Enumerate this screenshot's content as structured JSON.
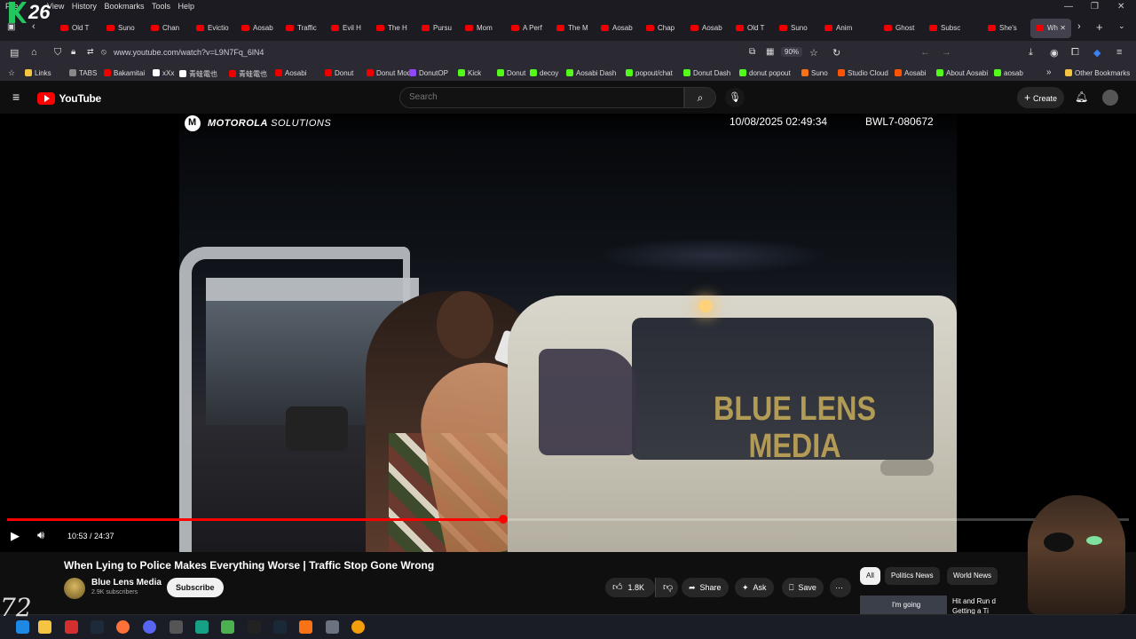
{
  "browser": {
    "menu": [
      "File",
      "View",
      "History",
      "Bookmarks",
      "Tools",
      "Help"
    ],
    "tabs": [
      "Old T",
      "Suno",
      "Chan",
      "Evictio",
      "Aosab",
      "Traffic",
      "Evil H",
      "The H",
      "Pursu",
      "Mom",
      "A Perf",
      "The M",
      "Aosab",
      "Chap",
      "Aosab",
      "Old T",
      "Suno",
      "Anim",
      "Ghost",
      "Subsc",
      "She's",
      "Wh"
    ],
    "url": "www.youtube.com/watch?v=L9N7Fq_6lN4",
    "zoom": "90%",
    "bookmarks": [
      "Links",
      "TABS",
      "Bakamitai",
      "xXx",
      "青蛙電也",
      "青蛙電也",
      "Aosabi",
      "Donut",
      "Donut Mod",
      "DonutOP",
      "Kick",
      "Donut",
      "decoy",
      "Aosabi Dash",
      "popout/chat",
      "Donut Dash",
      "donut popout",
      "Suno",
      "Studio Cloud",
      "Aosabi",
      "About Aosabi",
      "aosab",
      "Other Bookmarks"
    ]
  },
  "youtube": {
    "logo_text": "YouTube",
    "search_placeholder": "Search",
    "create_label": "Create"
  },
  "video": {
    "overlay_brand_bold": "MOTOROLA",
    "overlay_brand_light": "SOLUTIONS",
    "overlay_timestamp": "10/08/2025 02:49:34",
    "overlay_id": "BWL7-080672",
    "watermark_line1": "BLUE LENS",
    "watermark_line2": "MEDIA",
    "time_display": "10:53 / 24:37",
    "progress_fraction": 0.442
  },
  "details": {
    "title": "When Lying to Police Makes Everything Worse | Traffic Stop Gone Wrong",
    "channel_name": "Blue Lens Media",
    "subscribers": "2.9K subscribers",
    "subscribe_label": "Subscribe",
    "likes": "1.8K",
    "share_label": "Share",
    "ask_label": "Ask",
    "save_label": "Save",
    "chips": [
      "All",
      "Politics News",
      "World News"
    ],
    "rec_thumb_text": "I'm going",
    "rec_title": "Hit and Run d Getting a Ti"
  },
  "overlays": {
    "stream_logo_number": "26",
    "signature": "72"
  },
  "colors": {
    "accent_red": "#ff0000",
    "watermark_gold": "#c9ad5a",
    "background": "#0f0f0f"
  }
}
